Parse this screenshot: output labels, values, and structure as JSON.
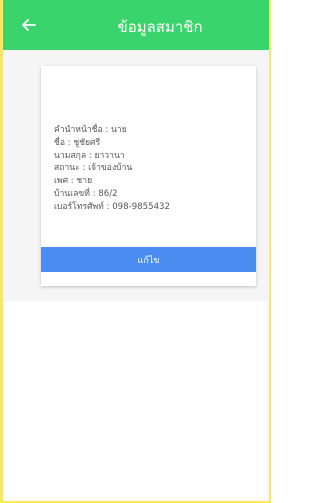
{
  "header": {
    "title": "ข้อมูลสมาชิก",
    "back_icon": "arrow-left-icon"
  },
  "member": {
    "lines": [
      "คำนำหน้าชื่อ : นาย",
      "ชื่อ : ชูชัยศรี",
      "นามสกุล : ยาวานา",
      "สถานะ : เจ้าของบ้าน",
      "เพศ : ชาย",
      "บ้านเลขที่ : 86/2",
      "เบอร์โทรศัพท์ : 098-9855432"
    ]
  },
  "actions": {
    "edit_label": "แก้ไข"
  },
  "colors": {
    "header": "#39d46b",
    "button": "#4a8cf0",
    "frame": "#fce56b"
  }
}
